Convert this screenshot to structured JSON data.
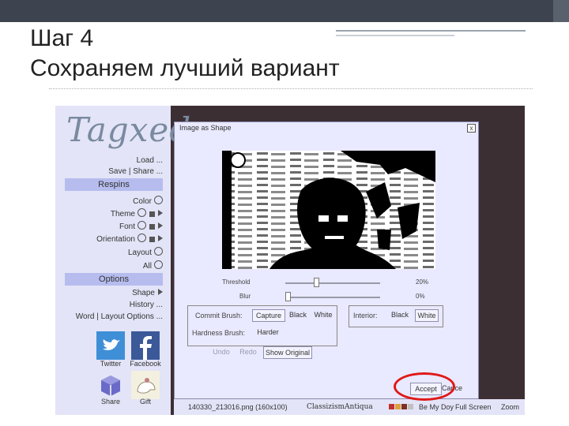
{
  "slide": {
    "title_line1": "Шаг 4",
    "title_line2": "Сохраняем лучший вариант"
  },
  "sidebar": {
    "logo": "Tagxedo",
    "load_label": "Load ...",
    "save_share_label": "Save | Share ...",
    "respins_header": "Respins",
    "items": [
      {
        "label": "Color",
        "lock": false,
        "arrow": false
      },
      {
        "label": "Theme",
        "lock": true,
        "arrow": true
      },
      {
        "label": "Font",
        "lock": true,
        "arrow": true
      },
      {
        "label": "Orientation",
        "lock": true,
        "arrow": true
      },
      {
        "label": "Layout",
        "lock": false,
        "arrow": false
      },
      {
        "label": "All",
        "lock": false,
        "arrow": false
      }
    ],
    "options_header": "Options",
    "shape_label": "Shape",
    "history_label": "History ...",
    "word_layout_label": "Word | Layout Options ...",
    "social": [
      {
        "label": "Twitter",
        "icon": "twitter-icon",
        "color": "#3f8fd6"
      },
      {
        "label": "Facebook",
        "icon": "facebook-icon",
        "color": "#3b5998"
      },
      {
        "label": "Share",
        "icon": "share-icon",
        "color": "#6a6ac8"
      },
      {
        "label": "Gift",
        "icon": "gift-icon",
        "color": "#f4f0e0"
      }
    ]
  },
  "dialog": {
    "title": "Image as Shape",
    "close_label": "x",
    "threshold_label": "Threshold",
    "threshold_value": "20%",
    "threshold_fraction": 0.3,
    "blur_label": "Blur",
    "blur_value": "0%",
    "blur_fraction": 0.0,
    "commit_brush_label": "Commit Brush:",
    "capture_label": "Capture",
    "black_label": "Black",
    "white_label": "White",
    "interior_label": "Interior:",
    "interior_black_label": "Black",
    "interior_white_label": "White",
    "hardness_label": "Hardness Brush:",
    "harder_label": "Harder",
    "undo_label": "Undo",
    "redo_label": "Redo",
    "show_original_label": "Show Original",
    "accept_label": "Accept",
    "cancel_label": "Cance"
  },
  "footer": {
    "filename": "140330_213016.png (160x100)",
    "font_name": "ClassizismAntiqua",
    "my_doy_label": "Be My Doy",
    "fullscreen_label": "Full Screen",
    "zoom_label": "Zoom",
    "swatches": [
      "#c03030",
      "#e0a040",
      "#803020",
      "#c0c0c0"
    ]
  },
  "colors": {
    "accent_sidebar": "#b6bcee",
    "highlight": "#e01818"
  }
}
